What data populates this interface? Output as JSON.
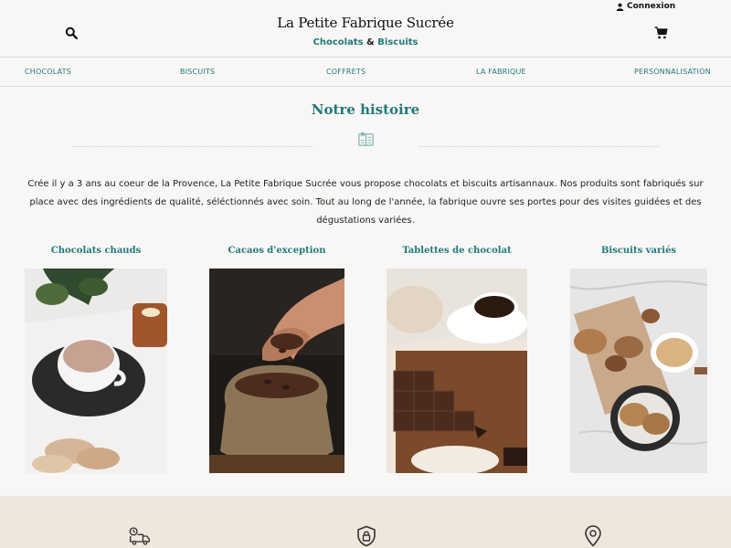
{
  "header": {
    "login_label": "Connexion",
    "brand": "La Petite Fabrique Sucrée",
    "tagline_part1": "Chocolats",
    "tagline_amp": "&",
    "tagline_part2": "Biscuits",
    "icons": [
      "user-icon",
      "search-icon",
      "cart-icon"
    ]
  },
  "nav": {
    "items": [
      {
        "label": "CHOCOLATS"
      },
      {
        "label": "BISCUITS"
      },
      {
        "label": "COFFRETS"
      },
      {
        "label": "LA FABRIQUE"
      },
      {
        "label": "PERSONNALISATION"
      }
    ]
  },
  "story": {
    "title": "Notre histoire",
    "icon": "book-icon",
    "text": "Crée il y a 3 ans au coeur de la Provence, La Petite Fabrique Sucrée vous propose chocolats et biscuits artisannaux. Nos produits sont fabriqués sur place avec des ingrédients de qualité, séléctionnés avec soin. Tout au long de l'année, la fabrique ouvre ses portes pour des visites guidées et des dégustations variées."
  },
  "products": [
    {
      "title": "Chocolats chauds"
    },
    {
      "title": "Cacaos d'exception"
    },
    {
      "title": "Tablettes de chocolat"
    },
    {
      "title": "Biscuits variés"
    }
  ],
  "footer_band": {
    "icons": [
      "delivery-truck-icon",
      "secure-payment-shield-icon",
      "location-pin-icon"
    ]
  },
  "colors": {
    "accent": "#1f7a78",
    "background": "#f9f7f5",
    "band": "#efe6dc"
  }
}
